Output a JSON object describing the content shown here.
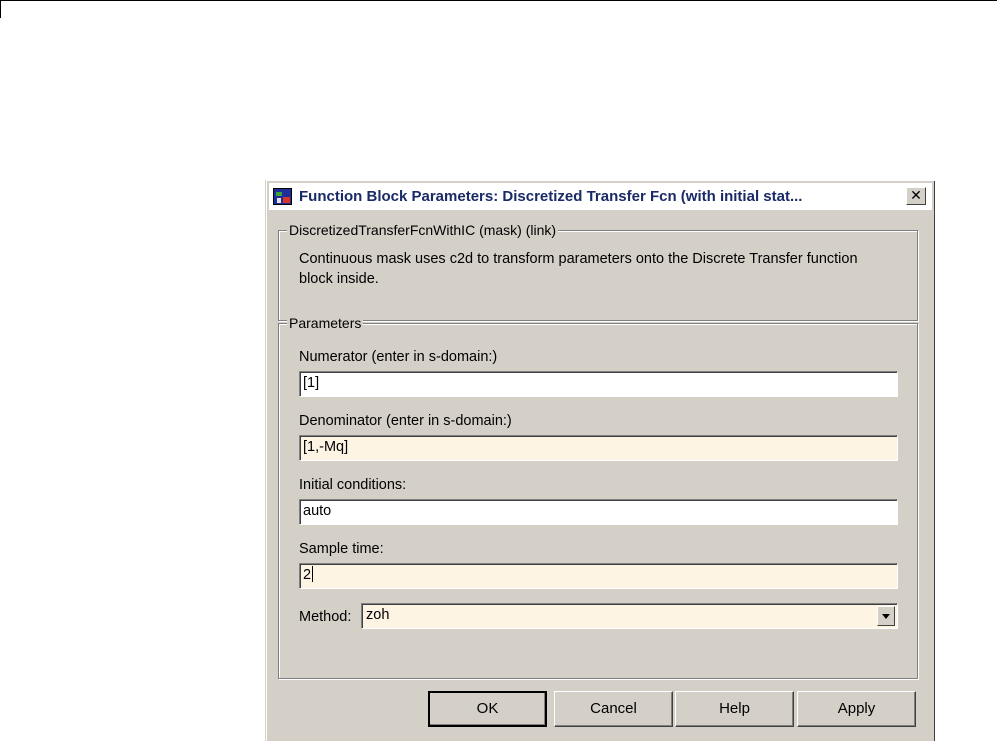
{
  "dialog": {
    "title": "Function Block Parameters: Discretized Transfer Fcn (with initial stat...",
    "close_symbol": "✕"
  },
  "description": {
    "legend": "DiscretizedTransferFcnWithIC (mask) (link)",
    "text": "Continuous mask uses c2d to transform parameters onto the Discrete Transfer function block inside."
  },
  "parameters": {
    "legend": "Parameters",
    "numerator": {
      "label": "Numerator (enter in s-domain:)",
      "value": "[1]"
    },
    "denominator": {
      "label": "Denominator (enter in s-domain:)",
      "value": "[1,-Mq]"
    },
    "initial_conditions": {
      "label": "Initial conditions:",
      "value": "auto"
    },
    "sample_time": {
      "label": "Sample time:",
      "value": "2"
    },
    "method": {
      "label": "Method:",
      "value": "zoh"
    }
  },
  "buttons": {
    "ok": "OK",
    "cancel": "Cancel",
    "help": "Help",
    "apply": "Apply"
  },
  "colors": {
    "dialog_bg": "#d4d0c8",
    "editable_field_bg": "#fdf4e4",
    "field_bg": "#ffffff",
    "title_text": "#1a2a66"
  },
  "icons": [
    "simulink-block-icon",
    "close-icon",
    "dropdown-arrow-icon"
  ]
}
